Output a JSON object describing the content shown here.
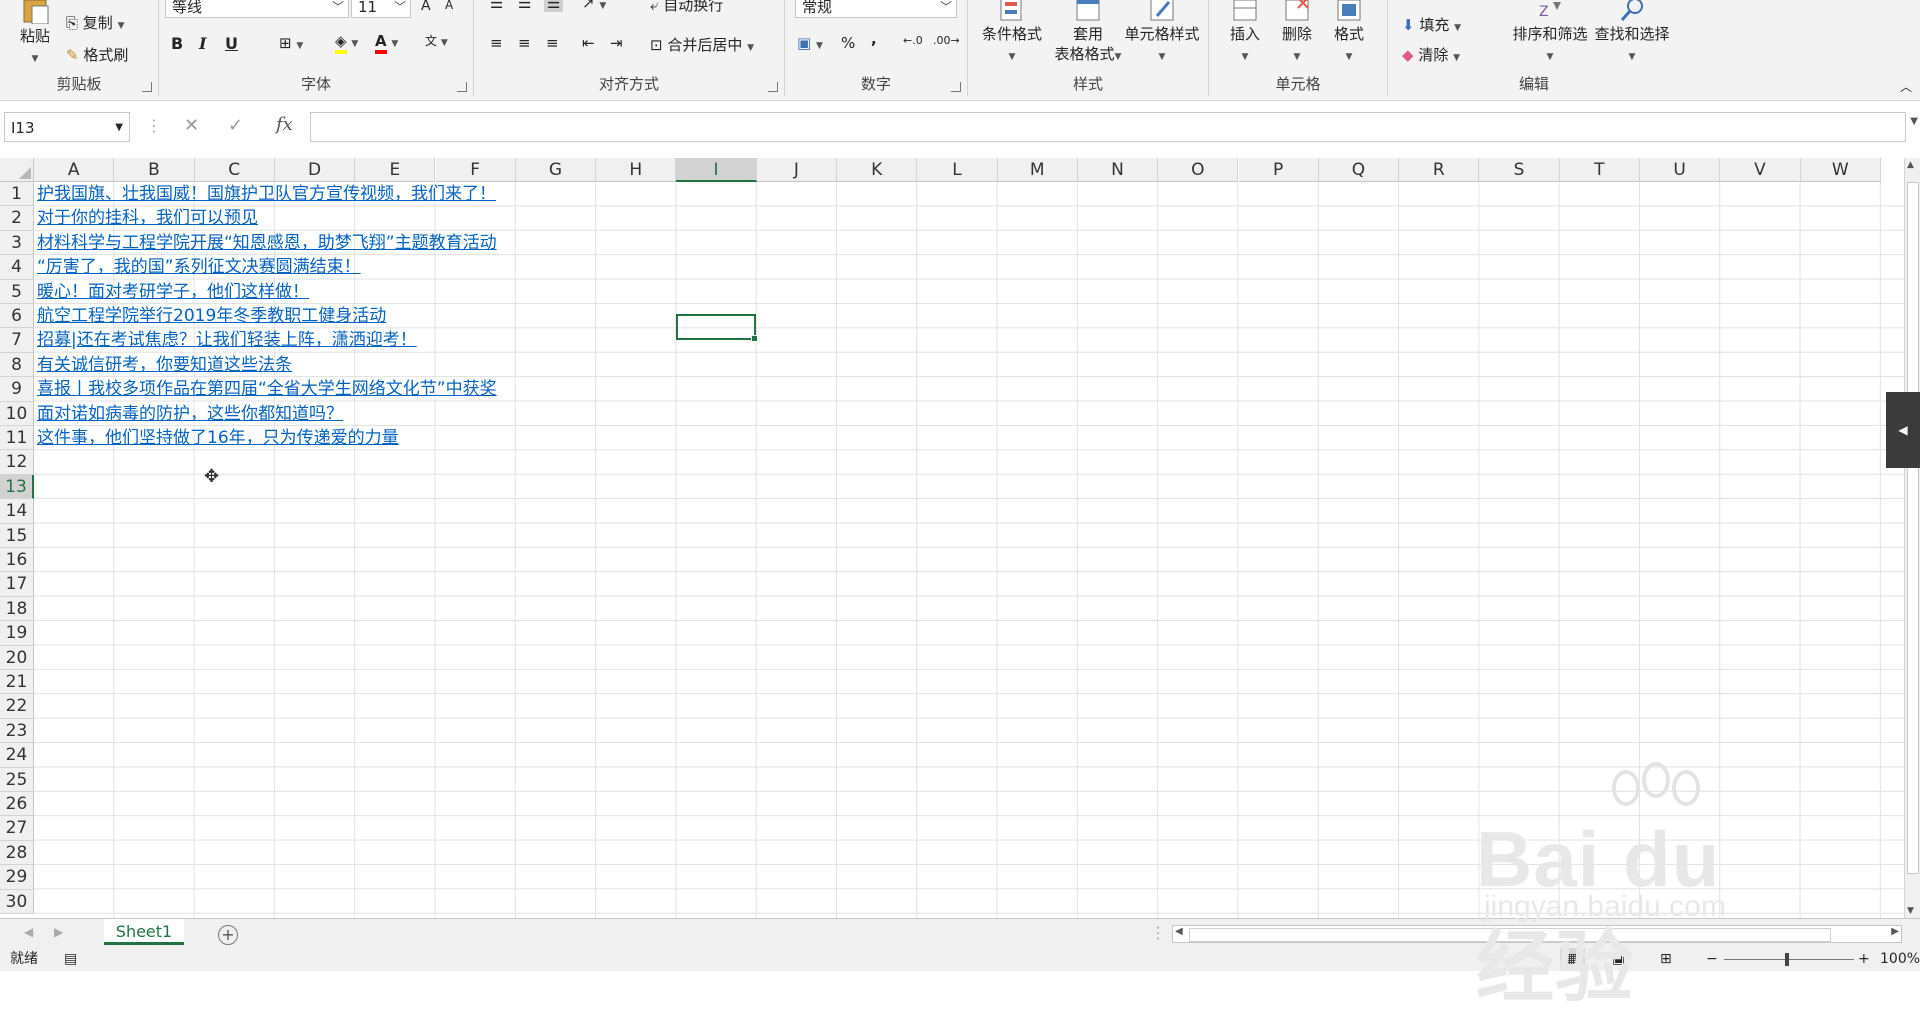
{
  "ribbon": {
    "clipboard": {
      "paste": "粘贴",
      "copy": "复制",
      "format_painter": "格式刷",
      "label": "剪贴板"
    },
    "font": {
      "name": "等线",
      "size": "11",
      "label": "字体",
      "bold": "B",
      "italic": "I",
      "underline": "U"
    },
    "alignment": {
      "wrap": "自动换行",
      "merge": "合并后居中",
      "label": "对齐方式"
    },
    "number": {
      "format": "常规",
      "percent": "%",
      "comma": ",",
      "label": "数字"
    },
    "styles": {
      "conditional": "条件格式",
      "table_1": "套用",
      "table_2": "表格格式",
      "cell_styles": "单元格样式",
      "label": "样式"
    },
    "cells": {
      "insert": "插入",
      "delete": "删除",
      "format": "格式",
      "label": "单元格"
    },
    "editing": {
      "fill": "填充",
      "clear": "清除",
      "sort": "排序和筛选",
      "find": "查找和选择",
      "label": "编辑"
    }
  },
  "formula_bar": {
    "name_box": "I13",
    "fx": "fx",
    "content": ""
  },
  "columns": [
    "A",
    "B",
    "C",
    "D",
    "E",
    "F",
    "G",
    "H",
    "I",
    "J",
    "K",
    "L",
    "M",
    "N",
    "O",
    "P",
    "Q",
    "R",
    "S",
    "T",
    "U",
    "V",
    "W"
  ],
  "selected_column": "I",
  "rows": [
    "1",
    "2",
    "3",
    "4",
    "5",
    "6",
    "7",
    "8",
    "9",
    "10",
    "11",
    "12",
    "13",
    "14",
    "15",
    "16",
    "17",
    "18",
    "19",
    "20",
    "21",
    "22",
    "23",
    "24",
    "25",
    "26",
    "27",
    "28",
    "29",
    "30"
  ],
  "selected_row": "13",
  "cells_A": [
    "护我国旗、壮我国威！国旗护卫队官方宣传视频，我们来了！",
    "对于你的挂科，我们可以预见",
    "材料科学与工程学院开展“知恩感恩，助梦飞翔”主题教育活动",
    "“厉害了，我的国”系列征文决赛圆满结束！",
    "暖心！面对考研学子，他们这样做！",
    "航空工程学院举行2019年冬季教职工健身活动",
    "招募|还在考试焦虑？让我们轻装上阵，潇洒迎考！",
    "有关诚信研考，你要知道这些法条",
    "喜报丨我校多项作品在第四届“全省大学生网络文化节”中获奖",
    "面对诺如病毒的防护，这些你都知道吗？",
    "这件事，他们坚持做了16年，只为传递爱的力量"
  ],
  "sheet_tab": "Sheet1",
  "status": {
    "ready": "就绪",
    "zoom": "100%"
  },
  "watermark": {
    "main": "Bai du 经验",
    "sub": "jingyan.baidu.com"
  }
}
